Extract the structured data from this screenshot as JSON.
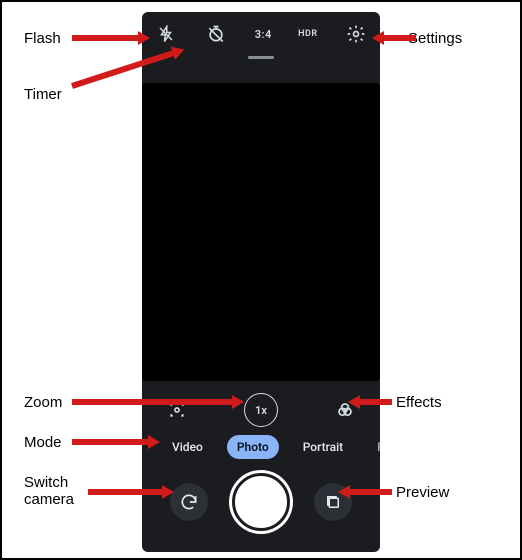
{
  "topbar": {
    "aspect_label": "3:4",
    "hdr_label": "HDR"
  },
  "zoom": {
    "label": "1x"
  },
  "modes": {
    "items": [
      "Video",
      "Photo",
      "Portrait",
      "Pro"
    ],
    "active_index": 1
  },
  "annotations": {
    "flash": "Flash",
    "timer": "Timer",
    "settings": "Settings",
    "zoom": "Zoom",
    "effects": "Effects",
    "mode": "Mode",
    "switch_camera": "Switch\ncamera",
    "preview": "Preview"
  }
}
